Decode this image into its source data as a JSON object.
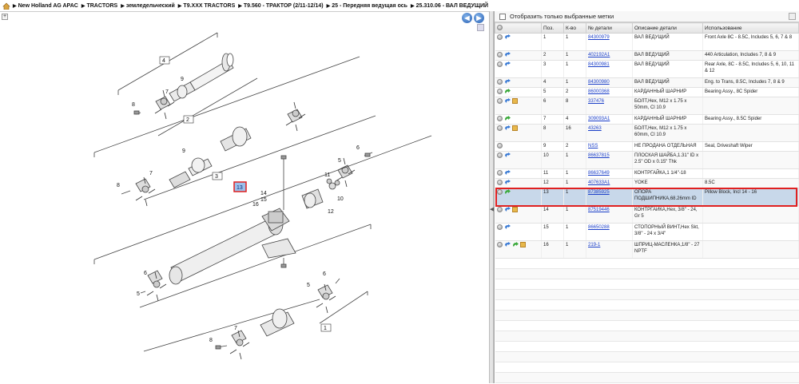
{
  "breadcrumb": [
    "New Holland AG APAC",
    "TRACTORS",
    "земледельческий",
    "T9.XXX TRACTORS",
    "T9.560 - ТРАКТОР (2/11-12/14)",
    "25 - Передняя ведущая ось",
    "25.310.06 - ВАЛ ВЕДУЩИЙ"
  ],
  "toolbar": {
    "zoom_label": "+",
    "back_label": "◀",
    "forward_label": "▶"
  },
  "filter": {
    "label": "Отобразить только выбранные метки"
  },
  "table": {
    "headers": [
      "",
      "Поз.",
      "К-во",
      "№ детали",
      "Описание детали",
      "Использование"
    ],
    "rows": [
      {
        "pos": "1",
        "qty": "1",
        "part": "84300979",
        "desc": "ВАЛ ВЕДУЩИЙ",
        "usage": "Front Axle 8C - 8.5C, Includes 5, 6, 7 & 8",
        "icons": [
          "blue"
        ]
      },
      {
        "pos": "2",
        "qty": "1",
        "part": "402192A1",
        "desc": "ВАЛ ВЕДУЩИЙ",
        "usage": "440 Articulation, Includes 7, 8 & 9",
        "icons": [
          "blue"
        ]
      },
      {
        "pos": "3",
        "qty": "1",
        "part": "84300981",
        "desc": "ВАЛ ВЕДУЩИЙ",
        "usage": "Rear Axle, 8C - 8.5C, Includes 5, 6, 10, 11 & 12",
        "icons": [
          "blue"
        ]
      },
      {
        "pos": "4",
        "qty": "1",
        "part": "84300980",
        "desc": "ВАЛ ВЕДУЩИЙ",
        "usage": "Eng. to Trans, 8.5C, Includes 7, 8 & 9",
        "icons": [
          "blue"
        ]
      },
      {
        "pos": "5",
        "qty": "2",
        "part": "86000368",
        "desc": "КАРДАННЫЙ ШАРНИР",
        "usage": "Bearing Assy., 8C Spider",
        "icons": [
          "green"
        ]
      },
      {
        "pos": "6",
        "qty": "8",
        "part": "337476",
        "desc": "БОЛТ,Hex, M12 x 1.75 x 50mm, Cl 10.9",
        "usage": "",
        "icons": [
          "blue",
          "box"
        ]
      },
      {
        "pos": "7",
        "qty": "4",
        "part": "309093A1",
        "desc": "КАРДАННЫЙ ШАРНИР",
        "usage": "Bearing Assy., 8.5C Spider",
        "icons": [
          "green"
        ]
      },
      {
        "pos": "8",
        "qty": "16",
        "part": "43263",
        "desc": "БОЛТ,Hex, M12 x 1.75 x 60mm, Cl 10.9",
        "usage": "",
        "icons": [
          "blue",
          "box"
        ]
      },
      {
        "pos": "9",
        "qty": "2",
        "part": "NSS",
        "desc": "НЕ ПРОДАНА ОТДЕЛЬНАЯ",
        "usage": "Seal, Driveshaft Wiper",
        "icons": []
      },
      {
        "pos": "10",
        "qty": "1",
        "part": "86637815",
        "desc": "ПЛОСКАЯ ШАЙБА,1.31\" ID x 2.5\" OD x 0.15\" Thk",
        "usage": "",
        "icons": [
          "blue"
        ]
      },
      {
        "pos": "11",
        "qty": "1",
        "part": "86637649",
        "desc": "КОНТРГАЙКА,1 1/4\"-18",
        "usage": "",
        "icons": [
          "blue"
        ]
      },
      {
        "pos": "12",
        "qty": "1",
        "part": "407633A1",
        "desc": "YOKE",
        "usage": "8.5C",
        "icons": [
          "blue"
        ]
      },
      {
        "pos": "13",
        "qty": "1",
        "part": "87385925",
        "desc": "ОПОРА ПОДШИПНИКА,68.26mm ID",
        "usage": "Pillow Block, Incl 14 - 16",
        "icons": [
          "green"
        ]
      },
      {
        "pos": "14",
        "qty": "1",
        "part": "87519446",
        "desc": "КОНТРГАЙКА,Hex, 3/8\" - 24, Gr 5",
        "usage": "",
        "icons": [
          "blue",
          "box"
        ]
      },
      {
        "pos": "15",
        "qty": "1",
        "part": "86650288",
        "desc": "СТОПОРНЫЙ ВИНТ,Hex Skt, 3/8\" - 24 x 3/4\"",
        "usage": "",
        "icons": [
          "blue"
        ]
      },
      {
        "pos": "16",
        "qty": "1",
        "part": "219-1",
        "desc": "ШПРИЦ-МАСЛЕНКА,1/8\" - 27 NPTF",
        "usage": "",
        "icons": [
          "blue",
          "green",
          "box"
        ]
      }
    ]
  },
  "diagram": {
    "callouts": [
      "1",
      "2",
      "3",
      "4",
      "5",
      "5",
      "5",
      "6",
      "6",
      "6",
      "7",
      "7",
      "7",
      "8",
      "8",
      "8",
      "9",
      "9",
      "10",
      "11",
      "12",
      "13",
      "14",
      "15",
      "16"
    ],
    "selected_callout": "13"
  },
  "colors": {
    "selection": "#c8d8ea",
    "highlight_border": "#e02020",
    "link": "#1a3ec8"
  }
}
